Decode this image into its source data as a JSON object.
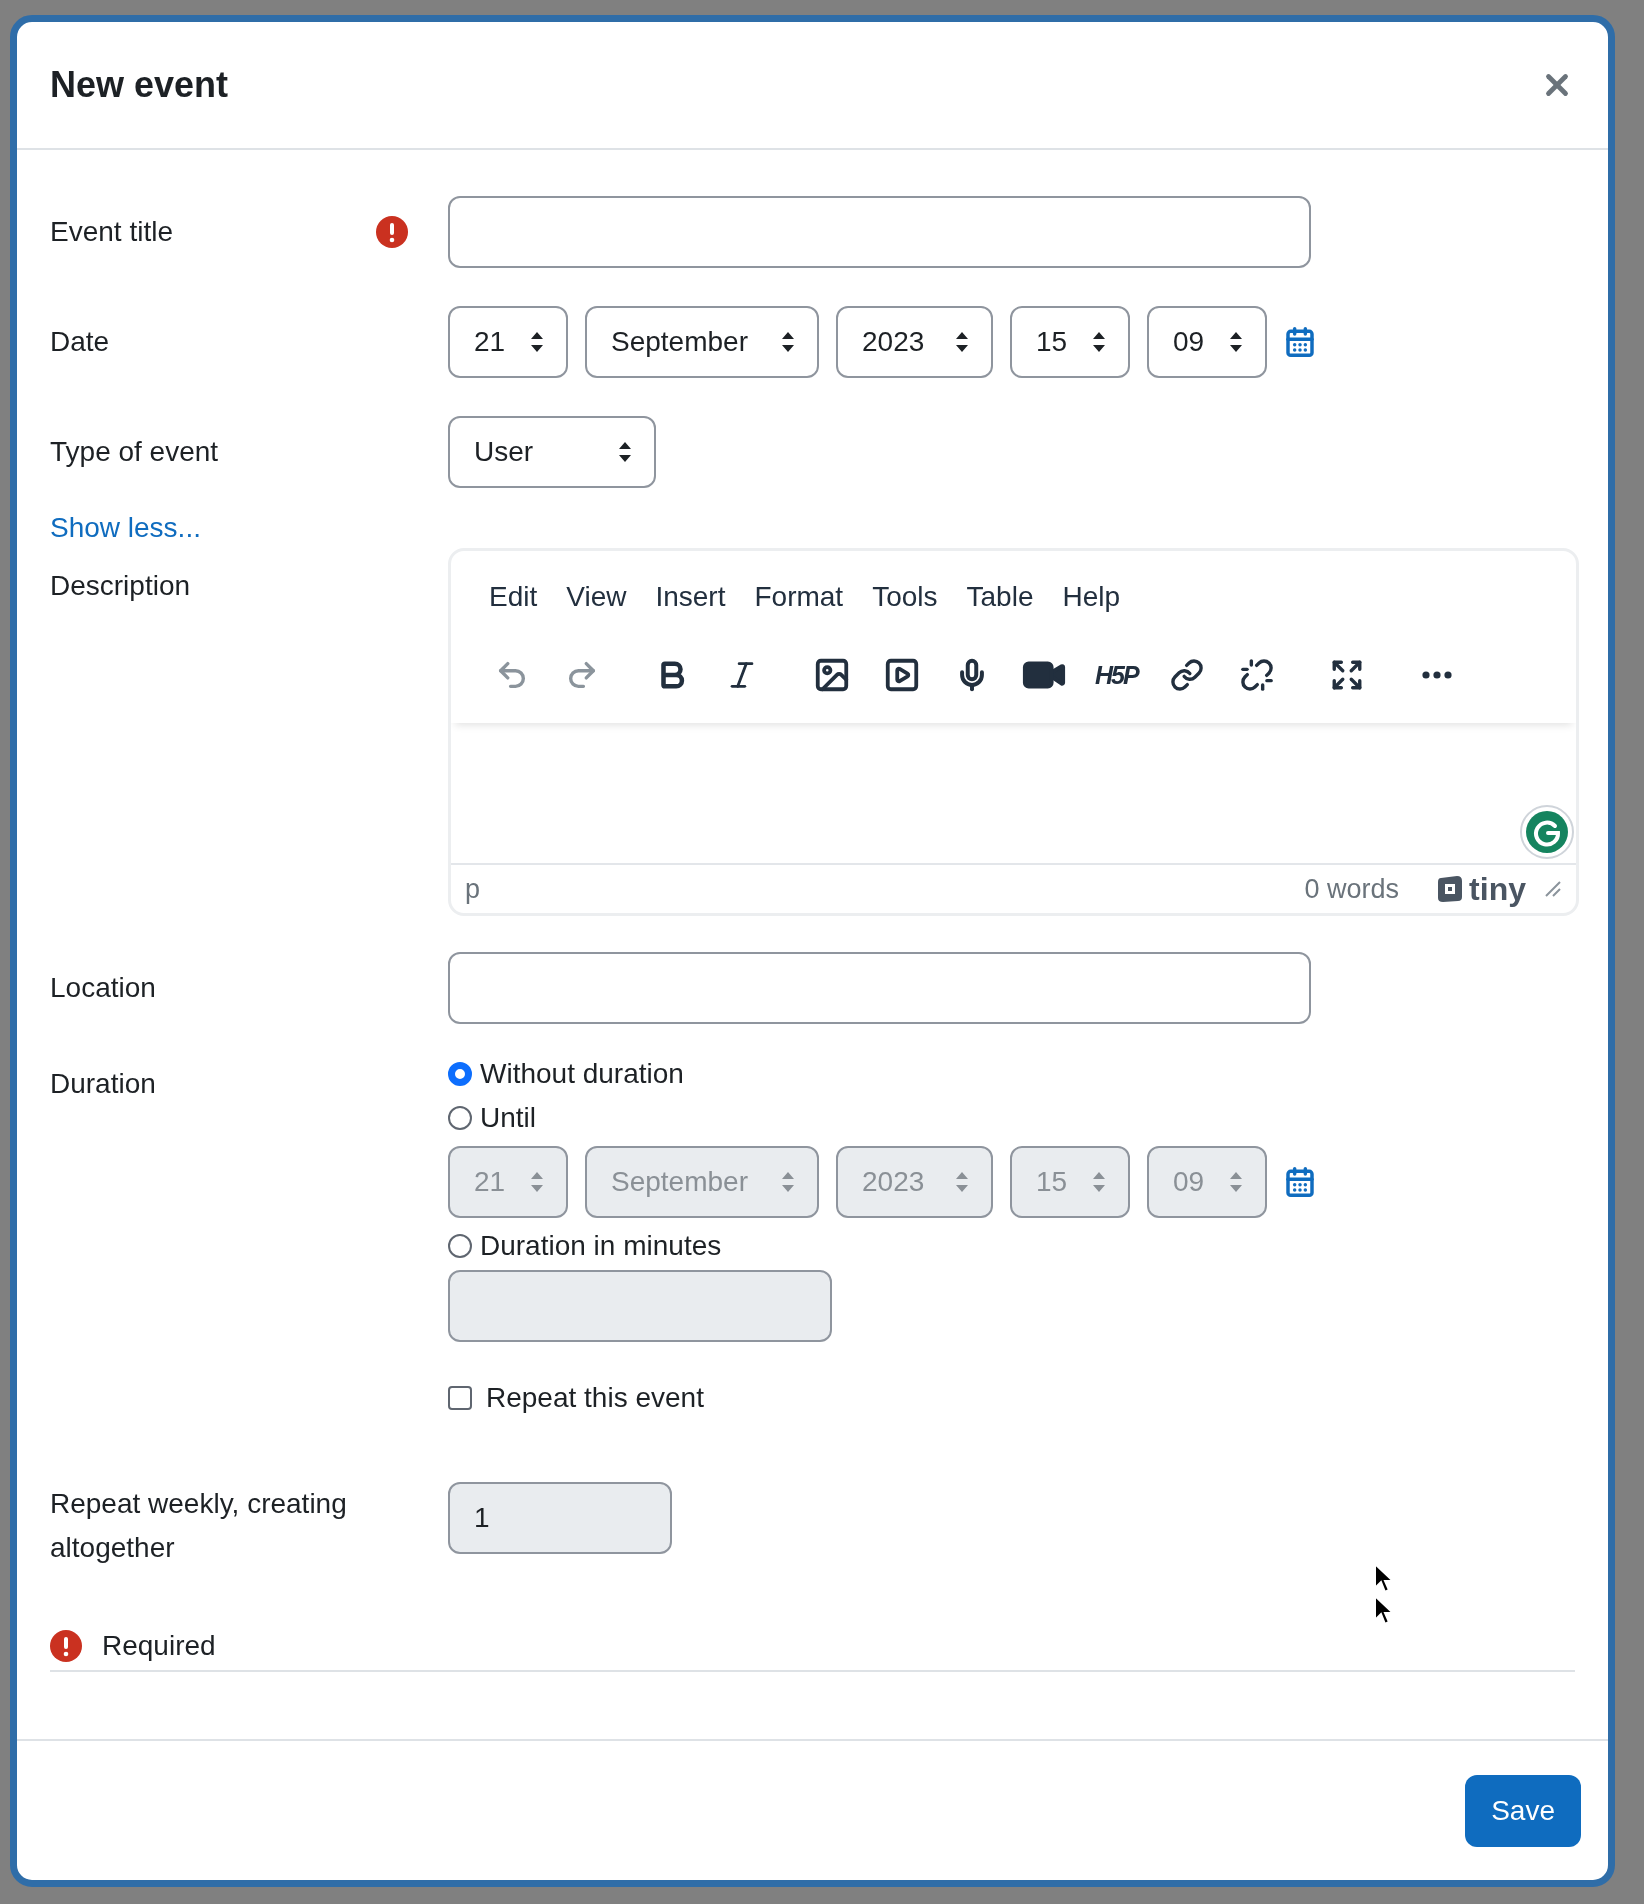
{
  "title": "New event",
  "event_title": {
    "label": "Event title",
    "required": true
  },
  "date": {
    "label": "Date",
    "disabled": false,
    "parts": [
      {
        "value": "21"
      },
      {
        "value": "September"
      },
      {
        "value": "2023"
      },
      {
        "value": "15"
      },
      {
        "value": "09"
      }
    ]
  },
  "type_of_event": {
    "label": "Type of event",
    "value": "User"
  },
  "show_less": "Show less...",
  "description": {
    "label": "Description",
    "menu": [
      "Edit",
      "View",
      "Insert",
      "Format",
      "Tools",
      "Table",
      "Help"
    ],
    "toolbar": [
      {
        "kind": "undo",
        "disabled": true
      },
      {
        "kind": "redo",
        "disabled": true
      },
      {
        "kind": "bold",
        "disabled": false
      },
      {
        "kind": "italic",
        "disabled": false
      },
      {
        "kind": "image",
        "disabled": false
      },
      {
        "kind": "media",
        "disabled": false
      },
      {
        "kind": "mic",
        "disabled": false
      },
      {
        "kind": "camera",
        "disabled": false
      },
      {
        "kind": "h5p",
        "disabled": false,
        "label": "H5P"
      },
      {
        "kind": "link",
        "disabled": false
      },
      {
        "kind": "unlink",
        "disabled": false
      },
      {
        "kind": "fullscreen",
        "disabled": false
      },
      {
        "kind": "more",
        "disabled": false
      }
    ],
    "path": "p",
    "word_count": "0 words",
    "brand": "tiny"
  },
  "location": {
    "label": "Location"
  },
  "duration": {
    "label": "Duration",
    "options": [
      {
        "label": "Without duration",
        "selected": true
      },
      {
        "label": "Until",
        "selected": false
      },
      {
        "label": "Duration in minutes",
        "selected": false
      }
    ],
    "until_date": {
      "disabled": true,
      "parts": [
        {
          "value": "21"
        },
        {
          "value": "September"
        },
        {
          "value": "2023"
        },
        {
          "value": "15"
        },
        {
          "value": "09"
        }
      ]
    },
    "minutes": {
      "disabled": true
    }
  },
  "repeat": {
    "label": "Repeat this event",
    "checked": false
  },
  "repeat_weekly": {
    "label": "Repeat weekly, creating altogether",
    "value": "1",
    "disabled": true
  },
  "required_note": "Required",
  "save": "Save"
}
